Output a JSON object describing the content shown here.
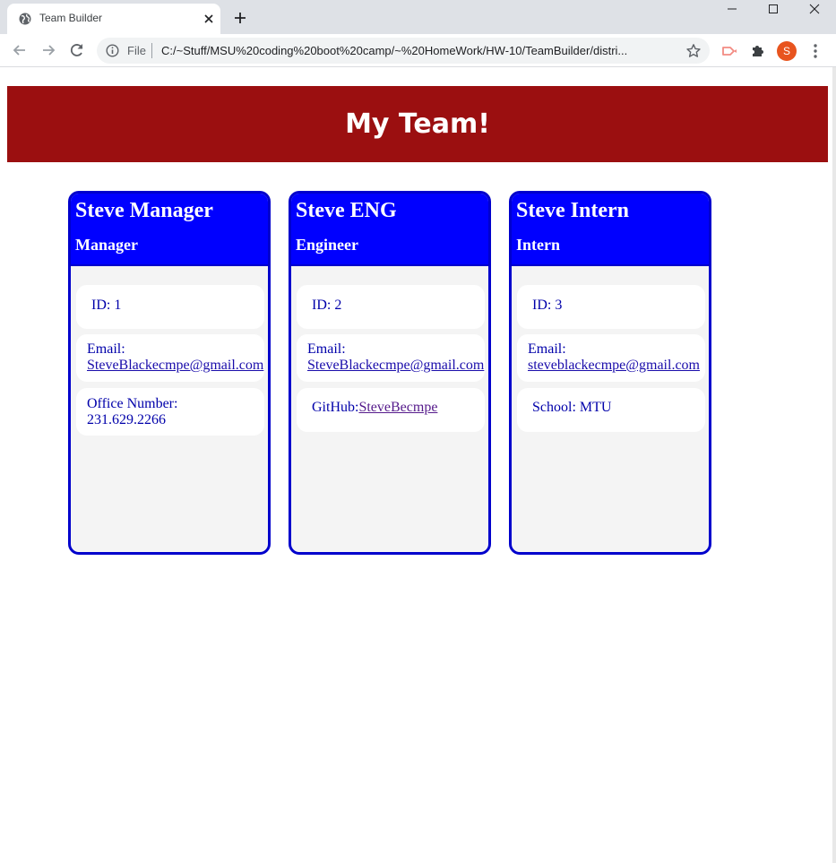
{
  "browser": {
    "tab_title": "Team Builder",
    "scheme_label": "File",
    "url": "C:/~Stuff/MSU%20coding%20boot%20camp/~%20HomeWork/HW-10/TeamBuilder/distri...",
    "avatar_letter": "S",
    "colors": {
      "chrome": "#dee1e6",
      "omnibox": "#f1f3f4",
      "avatar": "#e8541e"
    }
  },
  "page": {
    "heading": "My Team!",
    "colors": {
      "banner": "#9b0f10",
      "card_header": "#0000ff",
      "card_border": "#0000cc",
      "card_body": "#f4f4f4"
    }
  },
  "team": [
    {
      "name": "Steve Manager",
      "role": "Manager",
      "id_label": "ID: 1",
      "email_label": "Email:",
      "email": "SteveBlackecmpe@gmail.com",
      "extra_label": "Office Number:",
      "extra_value": "231.629.2266"
    },
    {
      "name": "Steve ENG",
      "role": "Engineer",
      "id_label": "ID: 2",
      "email_label": "Email:",
      "email": "SteveBlackecmpe@gmail.com",
      "extra_label": "GitHub:",
      "extra_value": "SteveBecmpe"
    },
    {
      "name": "Steve Intern",
      "role": "Intern",
      "id_label": "ID: 3",
      "email_label": "Email:",
      "email": "steveblackecmpe@gmail.com",
      "extra_label": "School: MTU"
    }
  ]
}
